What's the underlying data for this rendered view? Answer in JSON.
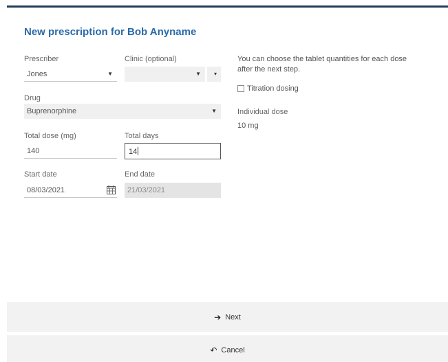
{
  "title": "New prescription for Bob Anyname",
  "prescriber": {
    "label": "Prescriber",
    "value": "Jones"
  },
  "clinic": {
    "label": "Clinic (optional)",
    "value": ""
  },
  "drug": {
    "label": "Drug",
    "value": "Buprenorphine"
  },
  "total_dose": {
    "label": "Total dose (mg)",
    "value": "140"
  },
  "total_days": {
    "label": "Total days",
    "value": "14"
  },
  "start_date": {
    "label": "Start date",
    "value": "08/03/2021"
  },
  "end_date": {
    "label": "End date",
    "value": "21/03/2021"
  },
  "info_text": "You can choose the tablet quantities for each dose after the next step.",
  "titration": {
    "label": "Titration dosing",
    "checked": false
  },
  "individual_dose": {
    "label": "Individual dose",
    "value": "10 mg"
  },
  "buttons": {
    "next": "Next",
    "cancel": "Cancel"
  },
  "icons": {
    "next": "arrow-right-icon",
    "cancel": "undo-icon",
    "calendar": "calendar-icon",
    "dropdown": "caret-down-icon"
  },
  "colors": {
    "title": "#2a6aa8",
    "header_border": "#1f3a5a",
    "footer_bg": "#f2f2f2"
  }
}
